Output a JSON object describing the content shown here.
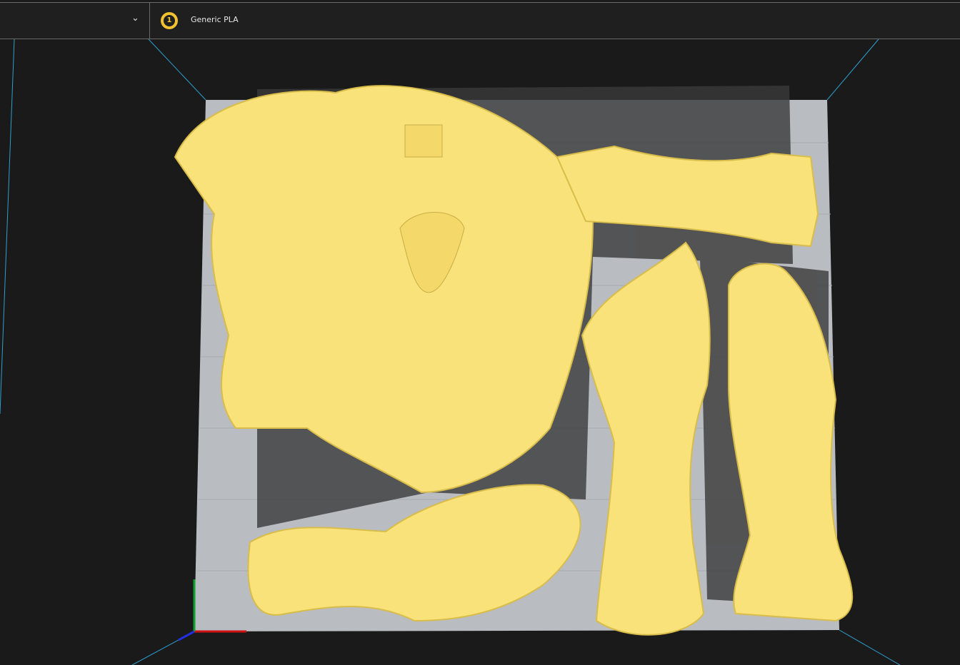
{
  "header": {
    "extruder_number": "1",
    "material": "Generic PLA"
  },
  "colors": {
    "model": "#f9e27a",
    "plate": "#b9bcc0",
    "background": "#1a1a1a",
    "frame": "#2e9fd0"
  }
}
